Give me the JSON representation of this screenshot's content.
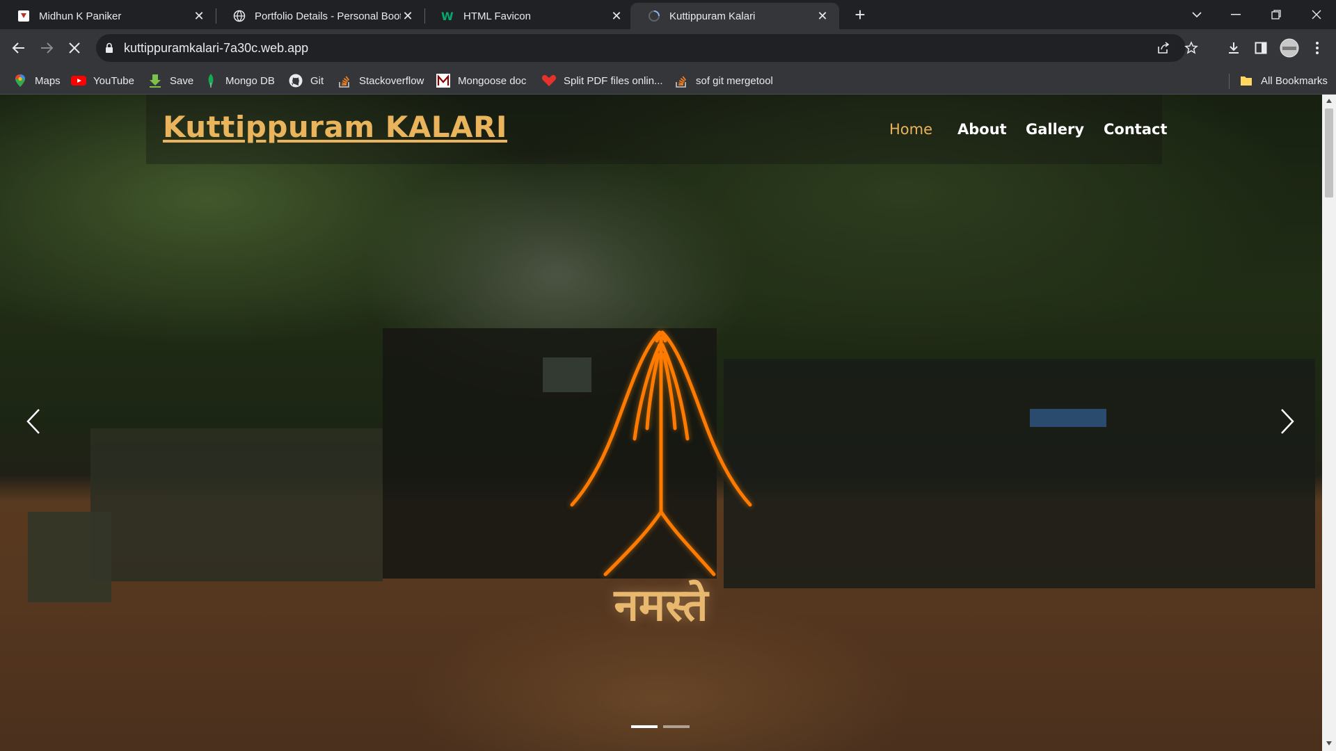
{
  "browser": {
    "tabs": [
      {
        "title": "Midhun K Paniker",
        "favicon": "shield-favicon",
        "active": false
      },
      {
        "title": "Portfolio Details - Personal Boot",
        "favicon": "globe-favicon",
        "active": false
      },
      {
        "title": "HTML Favicon",
        "favicon": "w-favicon",
        "active": false
      },
      {
        "title": "Kuttippuram Kalari",
        "favicon": "loading-favicon",
        "active": true
      }
    ],
    "new_tab_label": "+",
    "address": "kuttippuramkalari-7a30c.web.app",
    "bookmarks": [
      {
        "label": "Maps",
        "icon": "maps-pin-icon"
      },
      {
        "label": "YouTube",
        "icon": "youtube-icon"
      },
      {
        "label": "Save",
        "icon": "download-arrow-icon"
      },
      {
        "label": "Mongo DB",
        "icon": "mongodb-leaf-icon"
      },
      {
        "label": "Git",
        "icon": "github-icon"
      },
      {
        "label": "Stackoverflow",
        "icon": "stackoverflow-icon"
      },
      {
        "label": "Mongoose doc",
        "icon": "mongoose-icon"
      },
      {
        "label": "Split PDF files onlin...",
        "icon": "pdf-heart-icon"
      },
      {
        "label": "sof git mergetool",
        "icon": "stackoverflow-icon"
      }
    ],
    "all_bookmarks_label": "All Bookmarks"
  },
  "site": {
    "brand": "Kuttippuram KALARI",
    "nav": [
      {
        "label": "Home",
        "active": true
      },
      {
        "label": "About",
        "active": false
      },
      {
        "label": "Gallery",
        "active": false
      },
      {
        "label": "Contact",
        "active": false
      }
    ],
    "hero_text": "नमस्ते",
    "slides_total": 2,
    "active_slide": 1
  },
  "colors": {
    "accent": "#e9b45c",
    "namaste_icon": "#ff7a00",
    "chrome_dark": "#202124",
    "chrome_toolbar": "#35363a"
  }
}
